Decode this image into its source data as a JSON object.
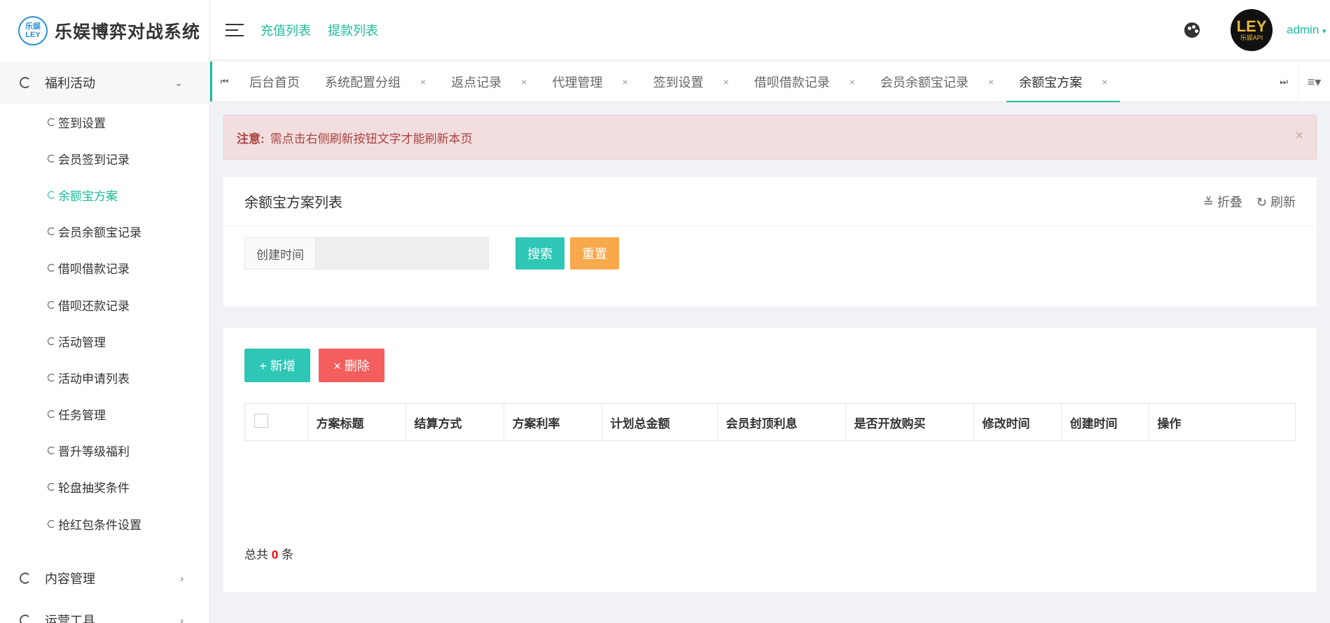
{
  "logo": {
    "mark_top": "乐娱",
    "mark_bottom": "LEY",
    "title": "乐娱博弈对战系统"
  },
  "sidebar": {
    "group_open": {
      "label": "福利活动",
      "arrow": "⌄"
    },
    "items": [
      {
        "label": "签到设置"
      },
      {
        "label": "会员签到记录"
      },
      {
        "label": "余额宝方案"
      },
      {
        "label": "会员余额宝记录"
      },
      {
        "label": "借呗借款记录"
      },
      {
        "label": "借呗还款记录"
      },
      {
        "label": "活动管理"
      },
      {
        "label": "活动申请列表"
      },
      {
        "label": "任务管理"
      },
      {
        "label": "晋升等级福利"
      },
      {
        "label": "轮盘抽奖条件"
      },
      {
        "label": "抢红包条件设置"
      }
    ],
    "group_content": {
      "label": "内容管理",
      "arrow": "›"
    },
    "group_ops": {
      "label": "运营工具",
      "arrow": "›"
    }
  },
  "header": {
    "links": [
      "充值列表",
      "提款列表"
    ],
    "avatar_text": "LEY",
    "avatar_sub": "乐娱API",
    "user": "admin",
    "user_caret": "▾"
  },
  "tabs": {
    "first_icon": "⏮",
    "last_icon": "⏭",
    "menu_icon": "≡▾",
    "close": "×",
    "items": [
      {
        "label": "后台首页"
      },
      {
        "label": "系统配置分组"
      },
      {
        "label": "返点记录"
      },
      {
        "label": "代理管理"
      },
      {
        "label": "签到设置"
      },
      {
        "label": "借呗借款记录"
      },
      {
        "label": "会员余额宝记录"
      },
      {
        "label": "余额宝方案"
      }
    ]
  },
  "notice": {
    "prefix": "注意:",
    "text": "需点击右侧刷新按钮文字才能刷新本页",
    "close": "×"
  },
  "search_panel": {
    "title": "余额宝方案列表",
    "collapse": "≚ 折叠",
    "refresh": "↻ 刷新",
    "field_label": "创建时间",
    "field_value": "",
    "search_btn": "搜索",
    "reset_btn": "重置"
  },
  "table_panel": {
    "add_btn": "+ 新增",
    "delete_btn": "× 删除",
    "columns": [
      "方案标题",
      "结算方式",
      "方案利率",
      "计划总金额",
      "会员封顶利息",
      "是否开放购买",
      "修改时间",
      "创建时间",
      "操作"
    ],
    "total_prefix": "总共",
    "total_count": "0",
    "total_suffix": "条"
  },
  "colors": {
    "accent": "#1bbc9b",
    "danger": "#f45e5e",
    "warning": "#f8a94b",
    "notice_bg": "#f2dede"
  }
}
